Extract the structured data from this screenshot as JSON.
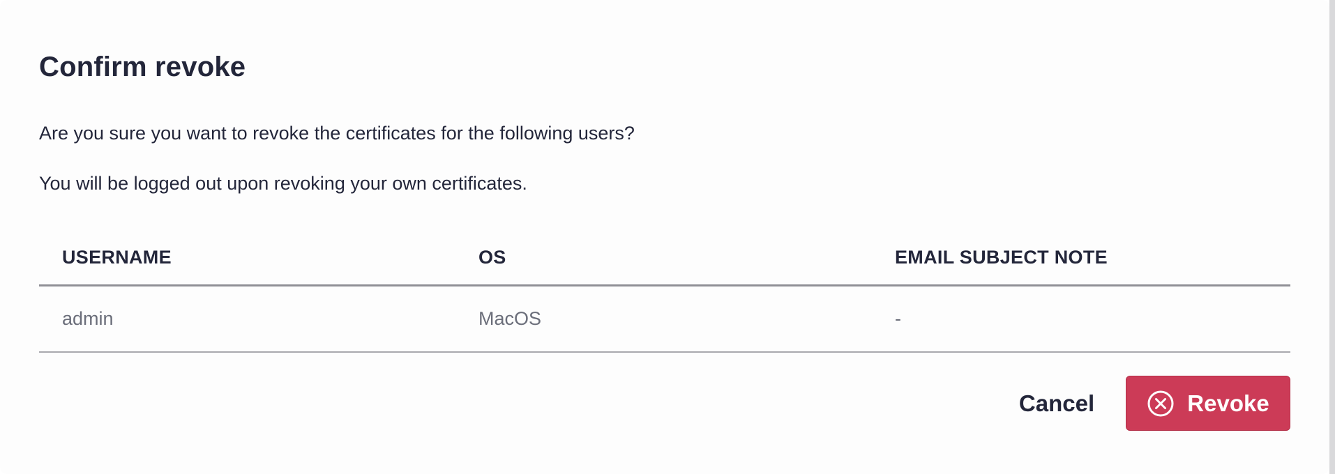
{
  "dialog": {
    "title": "Confirm revoke",
    "message_1": "Are you sure you want to revoke the certificates for the following users?",
    "message_2": "You will be logged out upon revoking your own certificates."
  },
  "table": {
    "columns": [
      "USERNAME",
      "OS",
      "EMAIL SUBJECT NOTE"
    ],
    "rows": [
      [
        "admin",
        "MacOS",
        "-"
      ]
    ]
  },
  "actions": {
    "cancel_label": "Cancel",
    "revoke_label": "Revoke",
    "revoke_icon": "x-circle-icon"
  },
  "colors": {
    "revoke_button": "#cc3b57",
    "text_primary": "#23263a",
    "text_muted": "#6b6e7a"
  }
}
